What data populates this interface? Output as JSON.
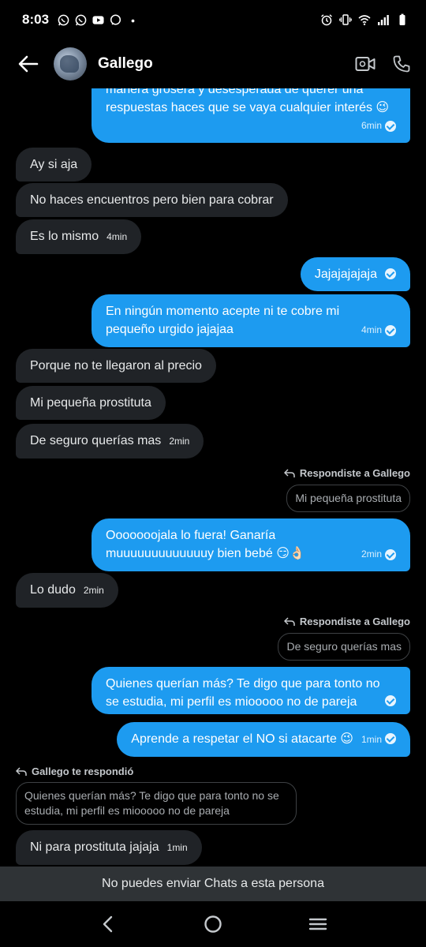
{
  "status_bar": {
    "time": "8:03",
    "left_icons": [
      "whatsapp-icon",
      "whatsapp-icon",
      "youtube-icon",
      "messenger-icon",
      "dot-icon"
    ],
    "right_icons": [
      "alarm-icon",
      "vibrate-icon",
      "wifi-icon",
      "signal-icon",
      "battery-icon"
    ]
  },
  "header": {
    "contact_name": "Gallego",
    "icons": [
      "back-arrow-icon",
      "avatar",
      "video-call-icon",
      "phone-icon"
    ]
  },
  "messages": [
    {
      "id": "m1",
      "dir": "out",
      "text_partial": "manera grosera y desesperada de querer una",
      "text": "respuestas haces que se vaya cualquier interés 😉",
      "time": "6min"
    },
    {
      "id": "m2",
      "dir": "in",
      "text": "Ay si aja"
    },
    {
      "id": "m3",
      "dir": "in",
      "text": "No haces encuentros pero bien para cobrar"
    },
    {
      "id": "m4",
      "dir": "in",
      "text": "Es lo mismo",
      "time": "4min"
    },
    {
      "id": "m5",
      "dir": "out",
      "text": "Jajajajajaja"
    },
    {
      "id": "m6",
      "dir": "out",
      "text": "En ningún momento acepte ni te cobre mi pequeño urgido jajajaa",
      "time": "4min"
    },
    {
      "id": "m7",
      "dir": "in",
      "text": "Porque no te llegaron al precio"
    },
    {
      "id": "m8",
      "dir": "in",
      "text": "Mi pequeña prostituta"
    },
    {
      "id": "m9",
      "dir": "in",
      "text": "De seguro querías mas",
      "time": "2min"
    },
    {
      "id": "m10",
      "dir": "out",
      "reply_label": "Respondiste a Gallego",
      "quote": "Mi pequeña prostituta",
      "text": "Ooooooojala lo fuera! Ganaría muuuuuuuuuuuuuy bien bebé 😏👌🏻",
      "time": "2min"
    },
    {
      "id": "m11",
      "dir": "in",
      "text": "Lo dudo",
      "time": "2min"
    },
    {
      "id": "m12",
      "dir": "out",
      "reply_label": "Respondiste a Gallego",
      "quote": "De seguro querías mas",
      "text": "Quienes querían más? Te digo que para tonto no se estudia, mi perfil es miooooo no de pareja"
    },
    {
      "id": "m13",
      "dir": "out",
      "text": "Aprende a respetar el NO si atacarte 😉",
      "time": "1min"
    },
    {
      "id": "m14",
      "dir": "in",
      "reply_label": "Gallego te respondió",
      "quote": "Quienes querían más? Te digo que para tonto no se estudia, mi perfil es miooooo no de pareja",
      "text": "Ni para prostituta jajaja",
      "time": "1min"
    }
  ],
  "footer": {
    "blocked_notice": "No puedes enviar Chats a esta persona"
  },
  "nav": {
    "icons": [
      "nav-back-icon",
      "nav-home-icon",
      "nav-recents-icon"
    ]
  },
  "colors": {
    "outgoing_bubble": "#1d9bf0",
    "incoming_bubble": "#202327",
    "background": "#000000"
  }
}
